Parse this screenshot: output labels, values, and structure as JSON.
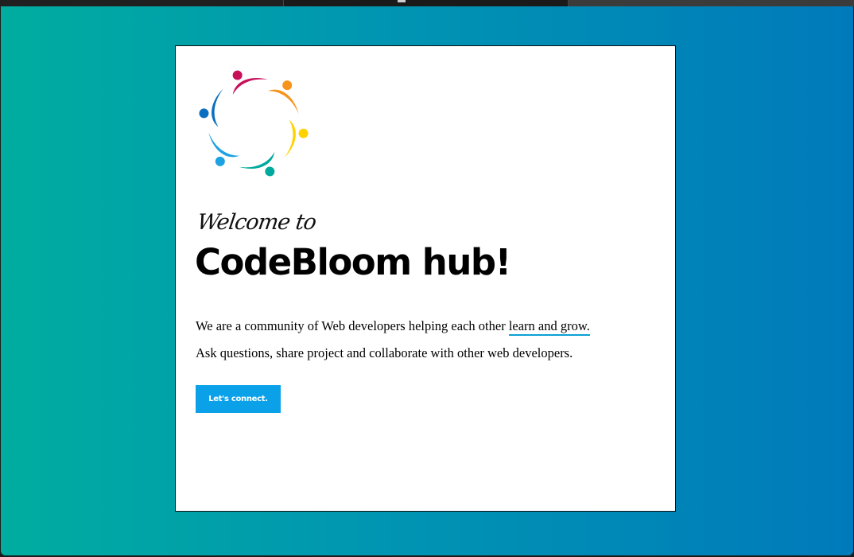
{
  "card": {
    "welcome": "Welcome to",
    "title": "CodeBloom hub!",
    "paragraph1_prefix": "We are a community of Web developers helping each other ",
    "paragraph1_link": "learn and grow.",
    "paragraph2": "Ask questions, share project and collaborate with other web developers.",
    "cta_label": "Let's connect."
  },
  "theme": {
    "gradient_start": "#00ad9f",
    "gradient_end": "#007abb",
    "button_color": "#0aa1e8",
    "link_underline": "#0aa0d6",
    "logo_colors": [
      "#c8105a",
      "#f7941d",
      "#ffd200",
      "#00a99d",
      "#1da1e2",
      "#0b6fc0"
    ]
  }
}
